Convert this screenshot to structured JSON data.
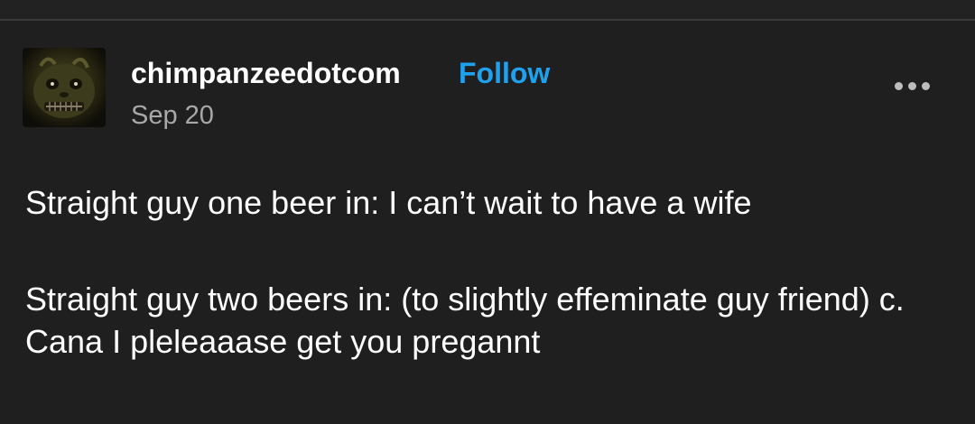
{
  "post": {
    "username": "chimpanzeedotcom",
    "follow_label": "Follow",
    "date": "Sep 20",
    "more_icon": "more-horizontal-icon",
    "avatar_icon": "animatronic-face-avatar",
    "paragraphs": [
      "Straight guy one beer in: I can’t wait to have a wife",
      "Straight guy two beers in: (to slightly effeminate guy friend) c. Cana I pleleaaase get you pregannt"
    ]
  },
  "colors": {
    "background": "#1f1f1f",
    "follow": "#1ea2f0",
    "date": "#a8a8a8",
    "text": "#ffffff"
  }
}
